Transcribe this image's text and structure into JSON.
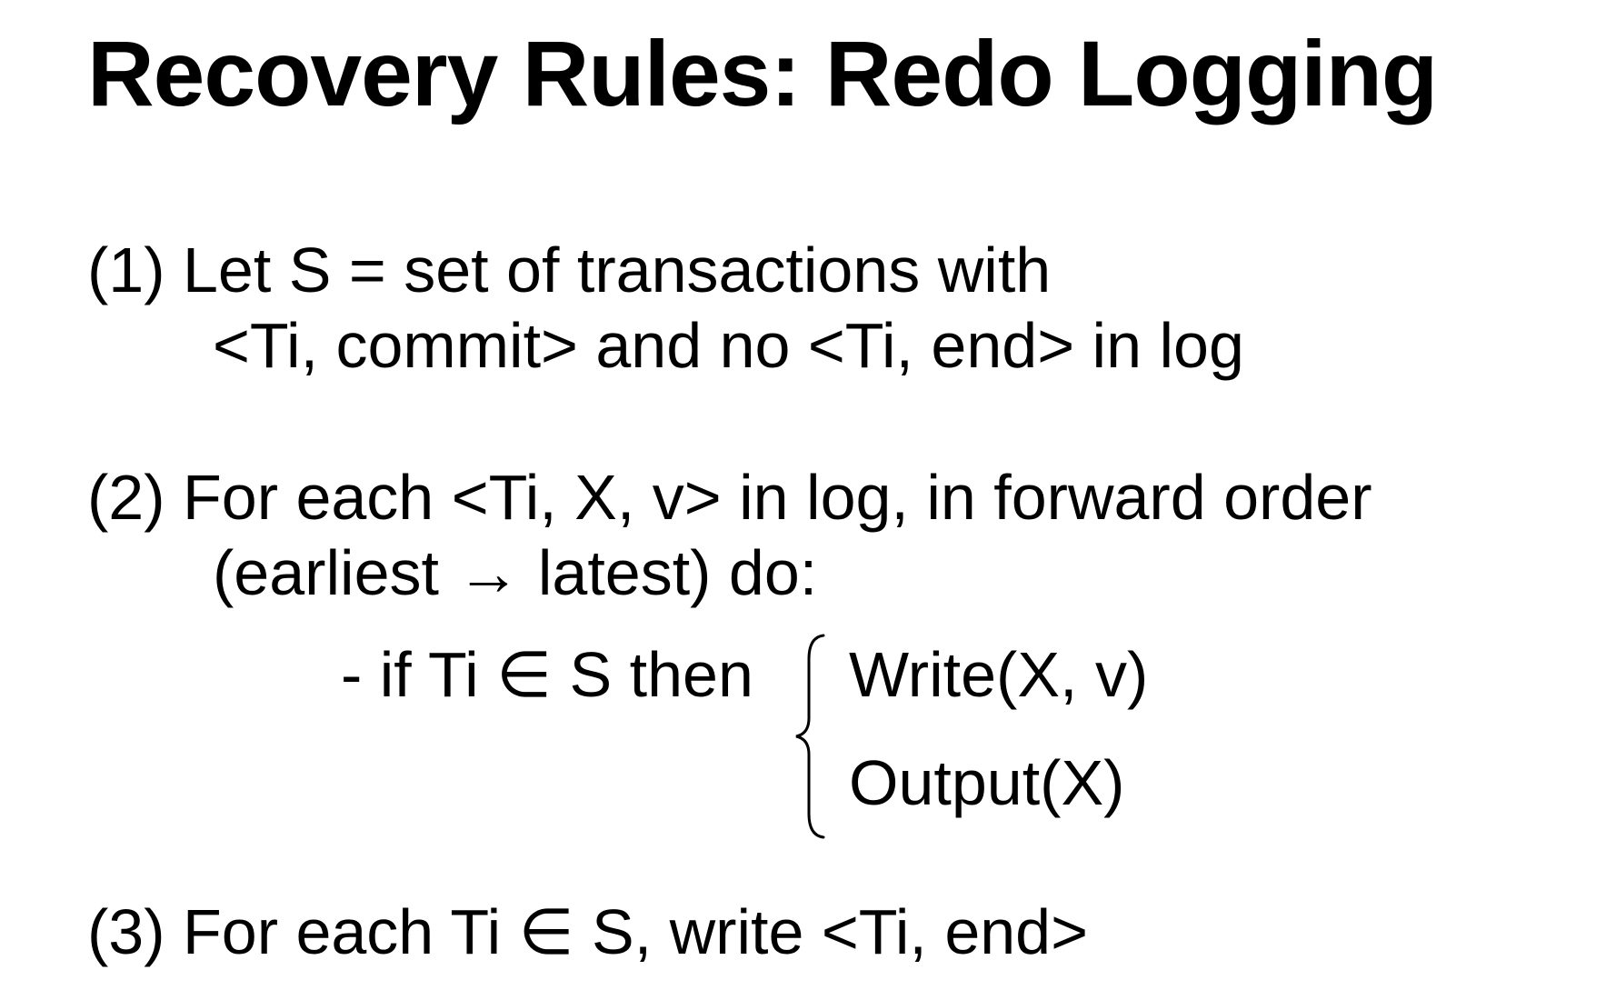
{
  "slide": {
    "title": "Recovery Rules: Redo Logging",
    "rule1": {
      "line1": "(1) Let S = set of transactions with",
      "line2": "<Ti, commit> and no <Ti, end> in log"
    },
    "rule2": {
      "line1": "(2) For each <Ti, X, v> in log, in forward order",
      "line2": "(earliest → latest) do:",
      "condition": "- if Ti ∈ S then",
      "actions": [
        "Write(X, v)",
        "Output(X)"
      ]
    },
    "rule3": {
      "line1": "(3) For each Ti ∈ S, write <Ti, end>"
    }
  }
}
